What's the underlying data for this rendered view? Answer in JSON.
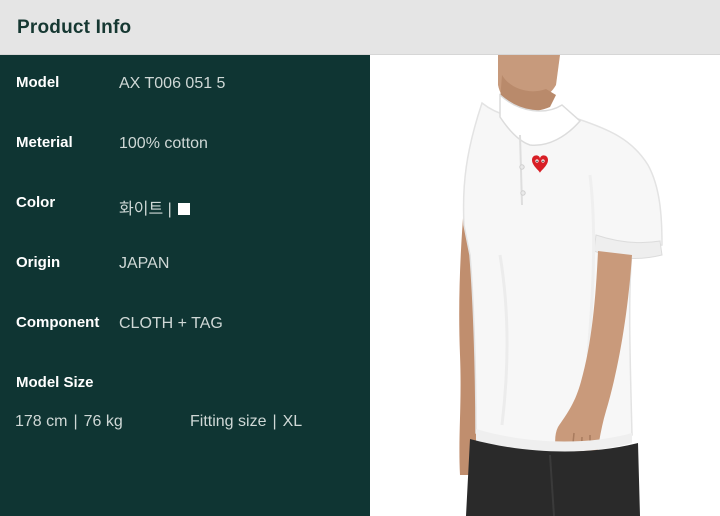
{
  "header": {
    "title": "Product Info"
  },
  "specs": [
    {
      "label": "Model",
      "value": "AX T006 051 5"
    },
    {
      "label": "Meterial",
      "value": "100% cotton"
    },
    {
      "label": "Color",
      "value": "화이트 |"
    },
    {
      "label": "Origin",
      "value": "JAPAN"
    },
    {
      "label": "Component",
      "value": "CLOTH + TAG"
    }
  ],
  "color_swatch": "#ffffff",
  "model_size": {
    "title": "Model Size",
    "height": "178 cm",
    "weight": "76 kg",
    "separator": "|",
    "fitting_label": "Fitting size",
    "fitting_value": "XL"
  },
  "colors": {
    "panel_bg": "#0f3533",
    "header_bg": "#e5e5e5",
    "heart_logo": "#d81f26"
  }
}
